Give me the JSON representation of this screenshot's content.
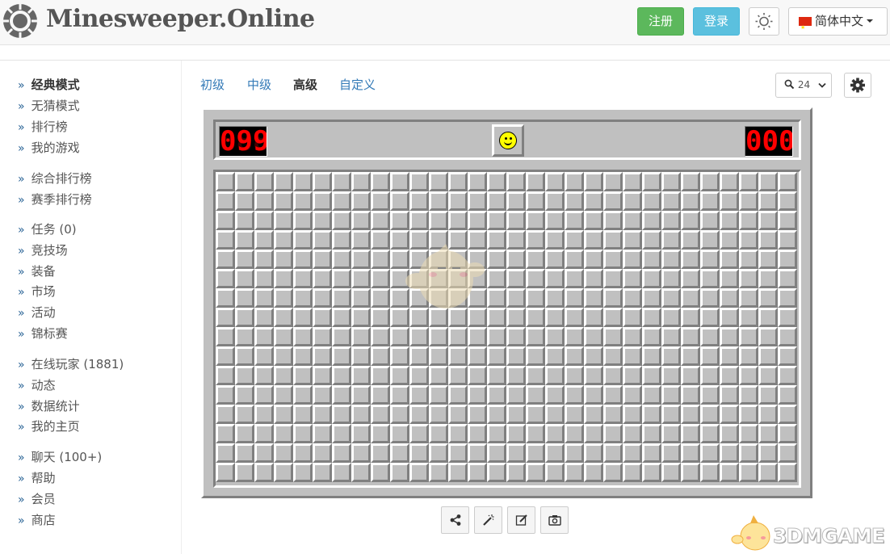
{
  "header": {
    "logo_text": "Minesweeper.Online",
    "register_label": "注册",
    "login_label": "登录",
    "theme_icon": "sun-icon",
    "language_label": "简体中文"
  },
  "sidebar": {
    "groups": [
      [
        "经典模式",
        "无猜模式",
        "排行榜",
        "我的游戏"
      ],
      [
        "综合排行榜",
        "赛季排行榜"
      ],
      [
        "任务 (0)",
        "竞技场",
        "装备",
        "市场",
        "活动",
        "锦标赛"
      ],
      [
        "在线玩家 (1881)",
        "动态",
        "数据统计",
        "我的主页"
      ],
      [
        "聊天 (100+)",
        "帮助",
        "会员",
        "商店"
      ]
    ],
    "items": {
      "classic": "经典模式",
      "no_guess": "无猜模式",
      "leaderboard": "排行榜",
      "my_games": "我的游戏",
      "overall_rank": "综合排行榜",
      "season_rank": "赛季排行榜",
      "quests": "任务 (0)",
      "arena": "竞技场",
      "equipment": "装备",
      "market": "市场",
      "events": "活动",
      "tournaments": "锦标赛",
      "online_players": "在线玩家 (1881)",
      "feed": "动态",
      "statistics": "数据统计",
      "my_profile": "我的主页",
      "chat": "聊天 (100+)",
      "help": "帮助",
      "premium": "会员",
      "shop": "商店"
    }
  },
  "levels": {
    "beginner": "初级",
    "intermediate": "中级",
    "expert": "高级",
    "custom": "自定义",
    "active": "expert"
  },
  "zoom": {
    "icon": "magnifier-icon",
    "value": "24"
  },
  "game": {
    "mines_counter": "099",
    "timer": "000",
    "face": "smiley",
    "columns": 30,
    "rows": 16
  },
  "toolbar": {
    "icons": [
      "share-icon",
      "magic-wand-icon",
      "edit-icon",
      "camera-icon"
    ]
  },
  "watermark": {
    "text": "3DMGAME"
  },
  "colors": {
    "register": "#5cb85c",
    "login": "#5bc0de",
    "link": "#337ab7",
    "board": "#c0c0c0",
    "counter_digits": "#ff0000"
  }
}
